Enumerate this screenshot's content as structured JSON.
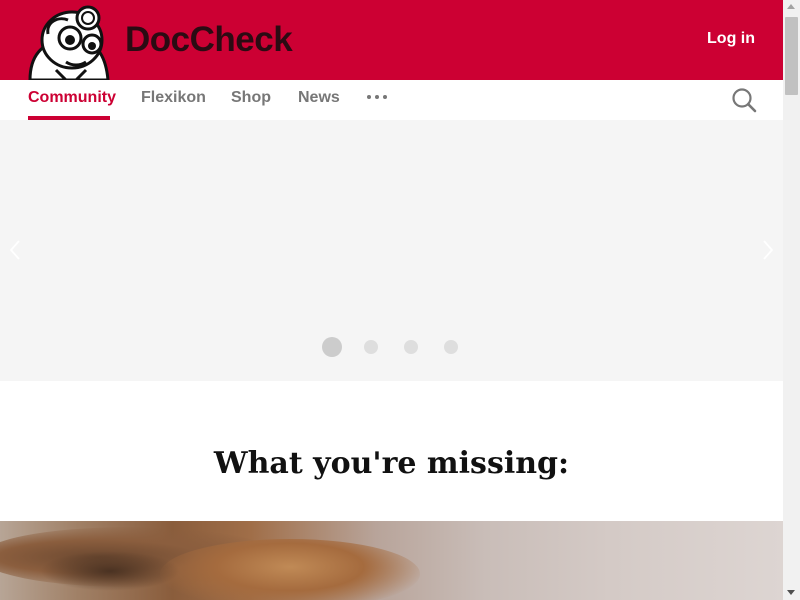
{
  "header": {
    "brand": "DocCheck",
    "login_label": "Log in",
    "background_color": "#cc0033"
  },
  "nav": {
    "items": [
      {
        "label": "Community",
        "active": true
      },
      {
        "label": "Flexikon",
        "active": false
      },
      {
        "label": "Shop",
        "active": false
      },
      {
        "label": "News",
        "active": false
      }
    ],
    "more_icon": "more-horizontal-icon",
    "search_icon": "search-icon",
    "active_color": "#cc0033"
  },
  "carousel": {
    "slide_count": 4,
    "active_slide": 1,
    "prev_icon": "chevron-left-icon",
    "next_icon": "chevron-right-icon"
  },
  "section": {
    "title": "What you're missing:"
  }
}
